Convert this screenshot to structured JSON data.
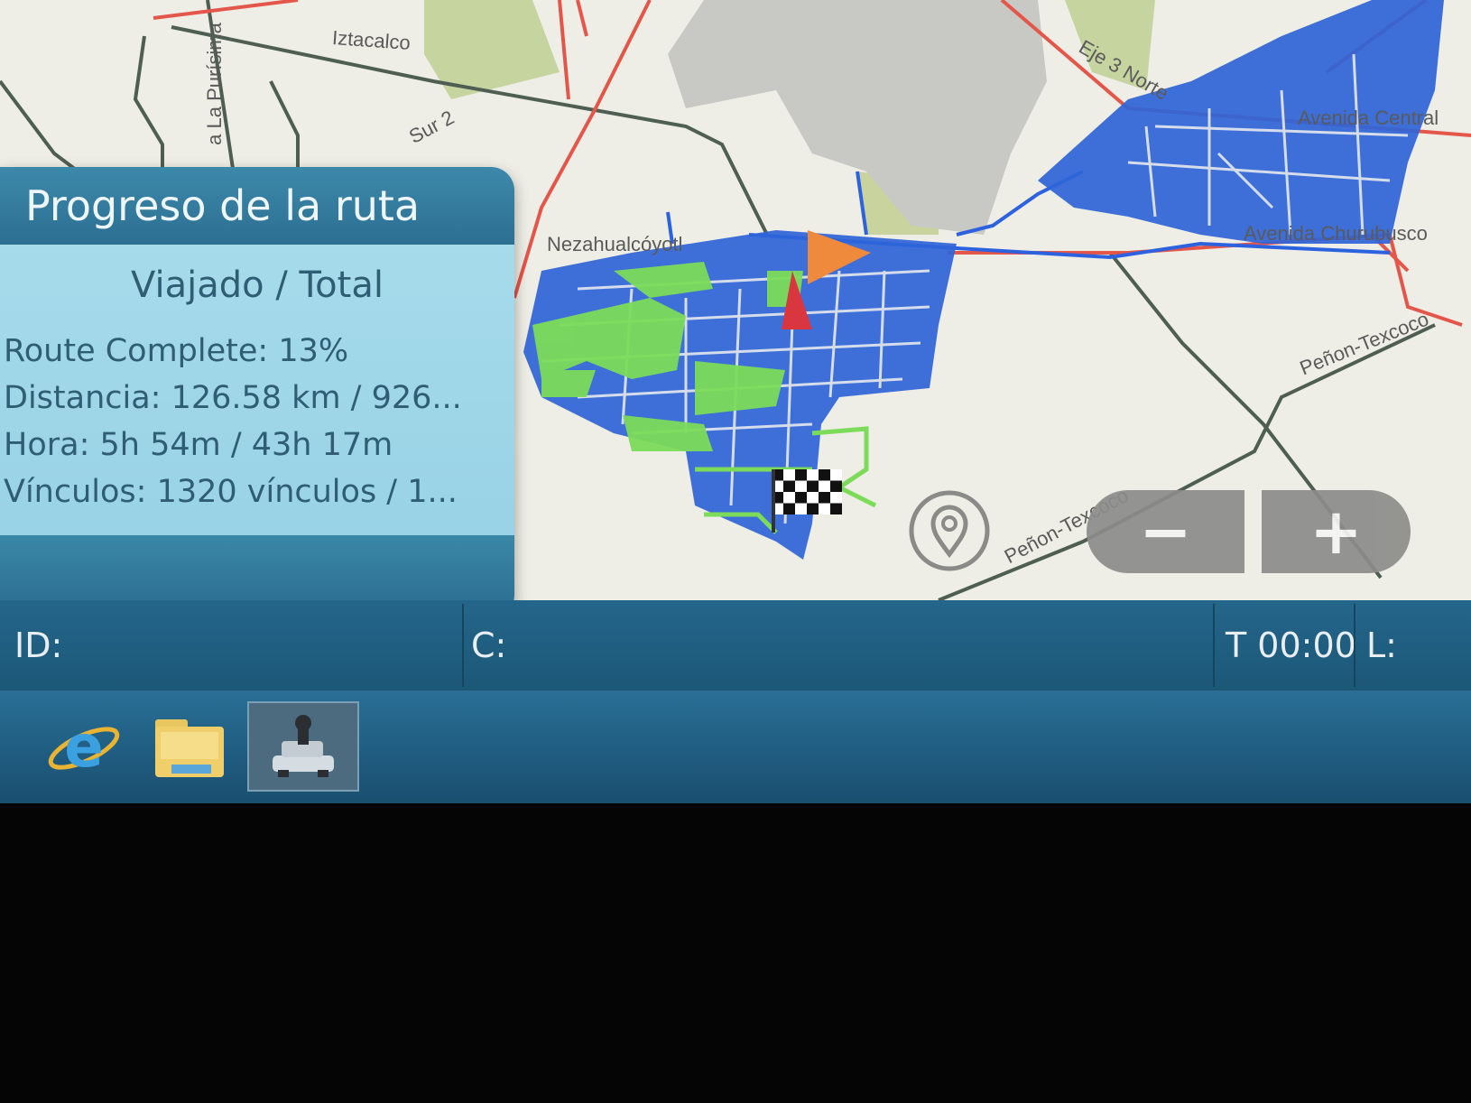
{
  "map": {
    "labels": {
      "iztacalco": "Iztacalco",
      "sur2": "Sur 2",
      "la_purisima": "a La Purísima",
      "nezahualcoyotl": "Nezahualcóyotl",
      "eje3norte": "Eje 3 Norte",
      "avenida_central": "Avenida Central",
      "avenida_churubusco": "Avenida Churubusco",
      "penon_texcoco_right": "Peñon-Texcoco",
      "penon_texcoco_bottom": "Peñon-Texcoco"
    }
  },
  "progress_panel": {
    "title": "Progreso de la ruta",
    "subtitle": "Viajado / Total",
    "route_complete": "Route Complete: 13%",
    "distance": "Distancia: 126.58 km / 926...",
    "time": "Hora: 5h 54m / 43h 17m",
    "links": "Vínculos: 1320 vínculos / 1..."
  },
  "zoom": {
    "out_label": "−",
    "in_label": "+"
  },
  "status_bar": {
    "id_label": "ID:",
    "c_label": "C:",
    "time": "T 00:00",
    "l_label": "L:"
  },
  "taskbar": {
    "icons": [
      "internet-explorer-icon",
      "folder-icon",
      "navigation-app-icon"
    ]
  }
}
